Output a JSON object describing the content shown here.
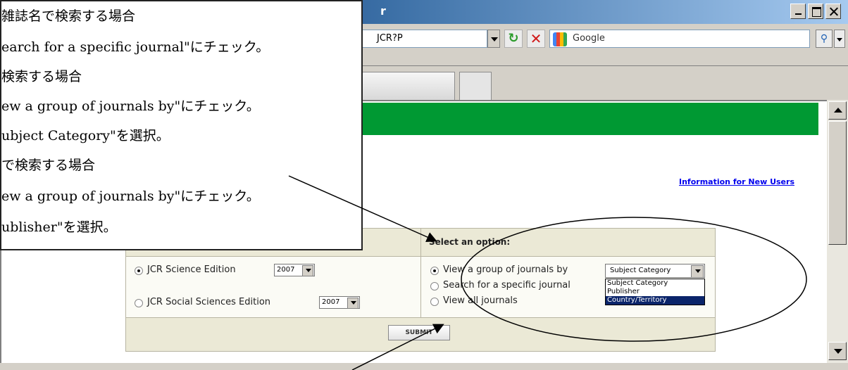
{
  "window": {
    "title_fragment": "r",
    "url_fragment": "JCR?P",
    "search_placeholder": "Google"
  },
  "page": {
    "info_link": "Information for New Users",
    "options_header": "Select an option:",
    "editions": [
      {
        "label": "JCR Science Edition",
        "year": "2007",
        "selected": true
      },
      {
        "label": "JCR Social Sciences Edition",
        "year": "2007",
        "selected": false
      }
    ],
    "options": [
      {
        "label": "View a group of journals by",
        "selected": true
      },
      {
        "label": "Search for a specific journal",
        "selected": false
      },
      {
        "label": "View all journals",
        "selected": false
      }
    ],
    "group_by_selected": "Subject Category",
    "group_by_options": [
      "Subject Category",
      "Publisher",
      "Country/Territory"
    ],
    "submit_label": "SUBMIT"
  },
  "callout": {
    "lines": [
      "雑誌名で検索する場合",
      "earch for a specific journal\"にチェック。",
      "検索する場合",
      "ew a group of journals by\"にチェック。",
      "ubject Category\"を選択。",
      "で検索する場合",
      "ew a group of journals by\"にチェック。",
      "ublisher\"を選択。"
    ]
  },
  "colors": {
    "green_banner": "#009933",
    "title_bar": "#0a246a",
    "highlight": "#0a246a"
  }
}
